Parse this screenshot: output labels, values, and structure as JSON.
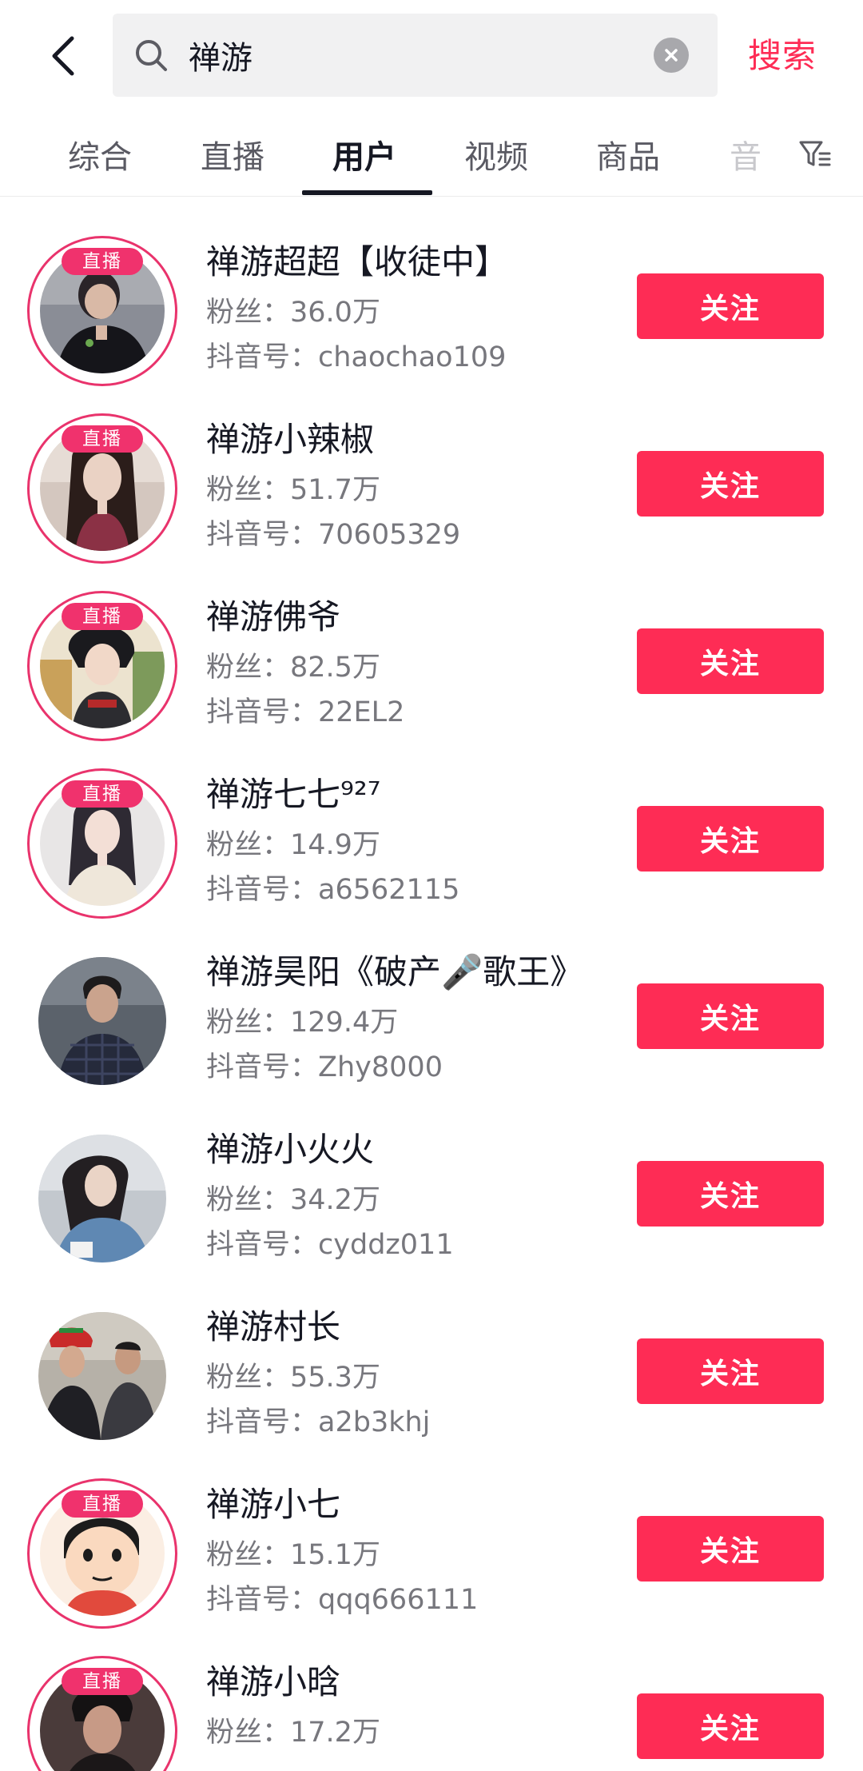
{
  "header": {
    "search_value": "禅游",
    "search_action": "搜索"
  },
  "tabs": [
    {
      "label": "综合",
      "active": false
    },
    {
      "label": "直播",
      "active": false
    },
    {
      "label": "用户",
      "active": true
    },
    {
      "label": "视频",
      "active": false
    },
    {
      "label": "商品",
      "active": false
    },
    {
      "label": "音",
      "active": false
    }
  ],
  "live_badge_label": "直播",
  "follow_label": "关注",
  "fans_prefix": "粉丝：",
  "id_prefix": "抖音号：",
  "colors": {
    "accent": "#fe2c55",
    "live_ring": "#e9336c"
  },
  "users": [
    {
      "name": "禅游超超【收徒中】",
      "fans": "36.0万",
      "douyin_id": "chaochao109",
      "live": true
    },
    {
      "name": "禅游小辣椒",
      "fans": "51.7万",
      "douyin_id": "70605329",
      "live": true
    },
    {
      "name": "禅游佛爷",
      "fans": "82.5万",
      "douyin_id": "22EL2",
      "live": true
    },
    {
      "name": "禅游七七⁹²⁷",
      "fans": "14.9万",
      "douyin_id": "a6562115",
      "live": true
    },
    {
      "name": "禅游昊阳《破产🎤歌王》",
      "fans": "129.4万",
      "douyin_id": "Zhy8000",
      "live": false
    },
    {
      "name": "禅游小火火",
      "fans": "34.2万",
      "douyin_id": "cyddz011",
      "live": false
    },
    {
      "name": "禅游村长",
      "fans": "55.3万",
      "douyin_id": "a2b3khj",
      "live": false
    },
    {
      "name": "禅游小七",
      "fans": "15.1万",
      "douyin_id": "qqq666111",
      "live": true
    },
    {
      "name": "禅游小晗",
      "fans": "17.2万",
      "douyin_id": "",
      "live": true
    }
  ]
}
